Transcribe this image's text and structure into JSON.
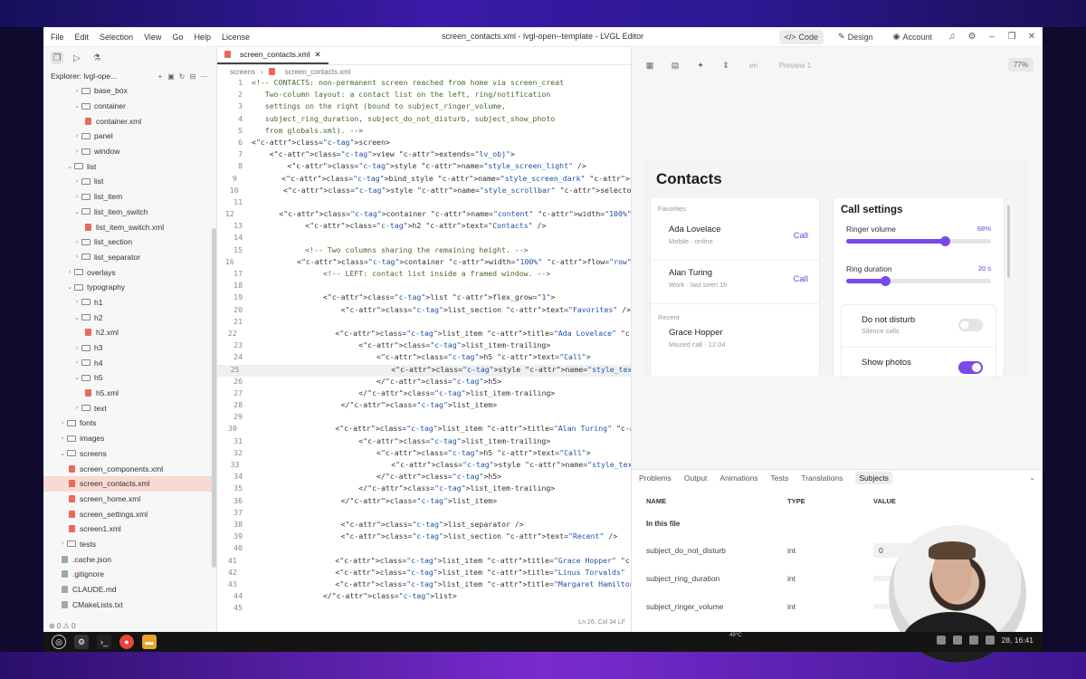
{
  "menubar": {
    "items": [
      "File",
      "Edit",
      "Selection",
      "View",
      "Go",
      "Help",
      "License"
    ],
    "title": "screen_contacts.xml - lvgl-open--template - LVGL Editor",
    "code_label": "Code",
    "design_label": "Design",
    "account_label": "Account"
  },
  "sidebar": {
    "explorer_label": "Explorer: lvgl-ope...",
    "tree": [
      {
        "label": "base_box",
        "depth": 1,
        "type": "folder",
        "open": false
      },
      {
        "label": "container",
        "depth": 1,
        "type": "folder",
        "open": true
      },
      {
        "label": "container.xml",
        "depth": 2,
        "type": "file"
      },
      {
        "label": "panel",
        "depth": 1,
        "type": "folder",
        "open": false
      },
      {
        "label": "window",
        "depth": 1,
        "type": "folder",
        "open": false
      },
      {
        "label": "list",
        "depth": 0,
        "type": "folder",
        "open": true
      },
      {
        "label": "list",
        "depth": 1,
        "type": "folder",
        "open": false
      },
      {
        "label": "list_item",
        "depth": 1,
        "type": "folder",
        "open": false
      },
      {
        "label": "list_item_switch",
        "depth": 1,
        "type": "folder",
        "open": true
      },
      {
        "label": "list_item_switch.xml",
        "depth": 2,
        "type": "file"
      },
      {
        "label": "list_section",
        "depth": 1,
        "type": "folder",
        "open": false
      },
      {
        "label": "list_separator",
        "depth": 1,
        "type": "folder",
        "open": false
      },
      {
        "label": "overlays",
        "depth": 0,
        "type": "folder",
        "open": false
      },
      {
        "label": "typography",
        "depth": 0,
        "type": "folder",
        "open": true
      },
      {
        "label": "h1",
        "depth": 1,
        "type": "folder",
        "open": false
      },
      {
        "label": "h2",
        "depth": 1,
        "type": "folder",
        "open": true
      },
      {
        "label": "h2.xml",
        "depth": 2,
        "type": "file"
      },
      {
        "label": "h3",
        "depth": 1,
        "type": "folder",
        "open": false
      },
      {
        "label": "h4",
        "depth": 1,
        "type": "folder",
        "open": false
      },
      {
        "label": "h5",
        "depth": 1,
        "type": "folder",
        "open": true
      },
      {
        "label": "h5.xml",
        "depth": 2,
        "type": "file"
      },
      {
        "label": "text",
        "depth": 1,
        "type": "folder",
        "open": false
      },
      {
        "label": "fonts",
        "depth": -1,
        "type": "folder",
        "open": false
      },
      {
        "label": "images",
        "depth": -1,
        "type": "folder",
        "open": false
      },
      {
        "label": "screens",
        "depth": -1,
        "type": "folder",
        "open": true
      },
      {
        "label": "screen_components.xml",
        "depth": 0,
        "type": "file"
      },
      {
        "label": "screen_contacts.xml",
        "depth": 0,
        "type": "file",
        "selected": true
      },
      {
        "label": "screen_home.xml",
        "depth": 0,
        "type": "file"
      },
      {
        "label": "screen_settings.xml",
        "depth": 0,
        "type": "file"
      },
      {
        "label": "screen1.xml",
        "depth": 0,
        "type": "file"
      },
      {
        "label": "tests",
        "depth": -1,
        "type": "folder",
        "open": false
      },
      {
        "label": ".cache.json",
        "depth": -1,
        "type": "file",
        "grey": true
      },
      {
        "label": ".gitignore",
        "depth": -1,
        "type": "file",
        "grey": true
      },
      {
        "label": "CLAUDE.md",
        "depth": -1,
        "type": "file",
        "grey": true
      },
      {
        "label": "CMakeLists.txt",
        "depth": -1,
        "type": "file",
        "grey": true
      }
    ],
    "status": "⊗ 0  ⚠ 0"
  },
  "editor": {
    "tab_label": "screen_contacts.xml",
    "breadcrumb": [
      "screens",
      "screen_contacts.xml"
    ],
    "lines": [
      {
        "n": "1",
        "t": "<!-- CONTACTS: non-permanent screen reached from home via screen_creat",
        "k": "cm"
      },
      {
        "n": "2",
        "t": "   Two-column layout: a contact list on the left, ring/notification",
        "k": "cm"
      },
      {
        "n": "3",
        "t": "   settings on the right (bound to subject_ringer_volume,",
        "k": "cm"
      },
      {
        "n": "4",
        "t": "   subject_ring_duration, subject_do_not_disturb, subject_show_photo",
        "k": "cm"
      },
      {
        "n": "5",
        "t": "   from globals.xml). -->",
        "k": "cm"
      },
      {
        "n": "6",
        "t": "<screen>",
        "k": "tag"
      },
      {
        "n": "7",
        "t": "    <view extends=\"lv_obj\">",
        "k": "x"
      },
      {
        "n": "8",
        "t": "        <style name=\"style_screen_light\" />",
        "k": "x"
      },
      {
        "n": "9",
        "t": "        <bind_style name=\"style_screen_dark\" subject=\"subject_theme_da",
        "k": "x"
      },
      {
        "n": "10",
        "t": "        <style name=\"style_scrollbar\" selector=\"scrollbar\" />",
        "k": "x"
      },
      {
        "n": "11",
        "t": "",
        "k": "x"
      },
      {
        "n": "12",
        "t": "        <container name=\"content\" width=\"100%\" height=\"100%\" pad=\"#spa",
        "k": "x"
      },
      {
        "n": "13",
        "t": "            <h2 text=\"Contacts\" />",
        "k": "x"
      },
      {
        "n": "14",
        "t": "",
        "k": "x"
      },
      {
        "n": "15",
        "t": "            <!-- Two columns sharing the remaining height. -->",
        "k": "cm"
      },
      {
        "n": "16",
        "t": "            <container width=\"100%\" flow=\"row\" gap=\"#space_lg\" grow=\"1",
        "k": "x"
      },
      {
        "n": "17",
        "t": "                <!-- LEFT: contact list inside a framed window. -->",
        "k": "cm"
      },
      {
        "n": "18",
        "t": "",
        "k": "x"
      },
      {
        "n": "19",
        "t": "                <list flex_grow=\"1\">",
        "k": "x"
      },
      {
        "n": "20",
        "t": "                    <list_section text=\"Favorites\" />",
        "k": "x"
      },
      {
        "n": "21",
        "t": "",
        "k": "x"
      },
      {
        "n": "22",
        "t": "                    <list_item title=\"Ada Lovelace\" subtitle=\"Mobile ·",
        "k": "x"
      },
      {
        "n": "23",
        "t": "                        <list_item-trailing>",
        "k": "x"
      },
      {
        "n": "24",
        "t": "                            <h5 text=\"Call\">",
        "k": "x"
      },
      {
        "n": "25",
        "t": "                                <style name=\"style_text_accent\" />",
        "k": "x",
        "hl": true
      },
      {
        "n": "26",
        "t": "                            </h5>",
        "k": "x"
      },
      {
        "n": "27",
        "t": "                        </list_item-trailing>",
        "k": "x"
      },
      {
        "n": "28",
        "t": "                    </list_item>",
        "k": "x"
      },
      {
        "n": "29",
        "t": "",
        "k": "x"
      },
      {
        "n": "30",
        "t": "                    <list_item title=\"Alan Turing\" subtitle=\"Work · la",
        "k": "x"
      },
      {
        "n": "31",
        "t": "                        <list_item-trailing>",
        "k": "x"
      },
      {
        "n": "32",
        "t": "                            <h5 text=\"Call\">",
        "k": "x"
      },
      {
        "n": "33",
        "t": "                                <style name=\"style_text_accent\" />",
        "k": "x"
      },
      {
        "n": "34",
        "t": "                            </h5>",
        "k": "x"
      },
      {
        "n": "35",
        "t": "                        </list_item-trailing>",
        "k": "x"
      },
      {
        "n": "36",
        "t": "                    </list_item>",
        "k": "x"
      },
      {
        "n": "37",
        "t": "",
        "k": "x"
      },
      {
        "n": "38",
        "t": "                    <list_separator />",
        "k": "x"
      },
      {
        "n": "39",
        "t": "                    <list_section text=\"Recent\" />",
        "k": "x"
      },
      {
        "n": "40",
        "t": "",
        "k": "x"
      },
      {
        "n": "41",
        "t": "                    <list_item title=\"Grace Hopper\" subtitle=\"Missed c",
        "k": "x"
      },
      {
        "n": "42",
        "t": "                    <list_item title=\"Linus Torvalds\" subtitle=\"Voicem",
        "k": "x"
      },
      {
        "n": "43",
        "t": "                    <list_item title=\"Margaret Hamilton\" subtitle=\"Mob",
        "k": "x"
      },
      {
        "n": "44",
        "t": "                </list>",
        "k": "x"
      },
      {
        "n": "45",
        "t": "",
        "k": "x"
      }
    ],
    "status": "Ln 26, Col 34   LF"
  },
  "preview": {
    "lang": "en",
    "preview_select": "Preview 1",
    "zoom": "77%",
    "title": "Contacts",
    "favorites_label": "Favorites",
    "recent_label": "Recent",
    "call_label": "Call",
    "contacts": [
      {
        "name": "Ada Lovelace",
        "sub": "Mobile · online"
      },
      {
        "name": "Alan Turing",
        "sub": "Work · last seen 1h"
      }
    ],
    "recent": [
      {
        "name": "Grace Hopper",
        "sub": "Missed call · 12:04"
      }
    ],
    "settings_title": "Call settings",
    "sliders": [
      {
        "label": "Ringer volume",
        "value": "68%",
        "fraction": 0.68
      },
      {
        "label": "Ring duration",
        "value": "20 s",
        "fraction": 0.27
      }
    ],
    "toggles": [
      {
        "label": "Do not disturb",
        "sub": "Silence calls",
        "on": false
      },
      {
        "label": "Show photos",
        "sub": "",
        "on": true
      }
    ],
    "accent": "#7a47e8"
  },
  "panel": {
    "tabs": [
      "Problems",
      "Output",
      "Animations",
      "Tests",
      "Translations",
      "Subjects"
    ],
    "active_tab": "Subjects",
    "columns": [
      "NAME",
      "TYPE",
      "VALUE"
    ],
    "group": "In this file",
    "rows": [
      {
        "name": "subject_do_not_disturb",
        "type": "int",
        "value": "0"
      },
      {
        "name": "subject_ring_duration",
        "type": "int",
        "value": ""
      },
      {
        "name": "subject_ringer_volume",
        "type": "int",
        "value": ""
      }
    ]
  },
  "taskbar": {
    "temp": "49°C",
    "clock": "28, 16:41"
  }
}
